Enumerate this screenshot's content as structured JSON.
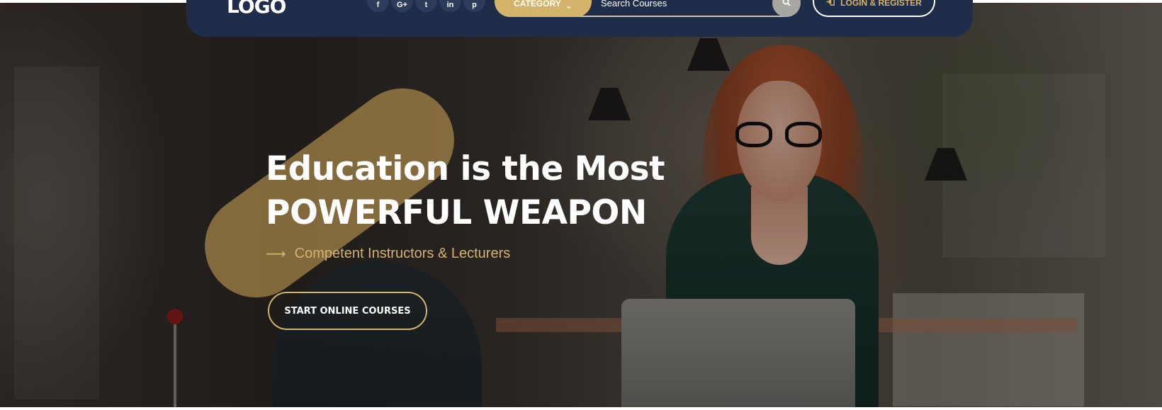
{
  "nav": {
    "logo": "LOGO",
    "socials": [
      {
        "icon": "facebook-icon",
        "glyph": "f"
      },
      {
        "icon": "google-plus-icon",
        "glyph": "G+"
      },
      {
        "icon": "twitter-icon",
        "glyph": "t"
      },
      {
        "icon": "linkedin-icon",
        "glyph": "in"
      },
      {
        "icon": "pinterest-icon",
        "glyph": "p"
      }
    ],
    "category_label": "CATEGORY",
    "category_chevron": "⌄",
    "search_placeholder": "Search Courses",
    "search_icon": "search-icon",
    "login_icon": "sign-in-icon",
    "login_label": "LOGIN & REGISTER"
  },
  "hero": {
    "headline_line1": "Education is the Most",
    "headline_line2": "POWERFUL WEAPON",
    "tagline_arrow": "⟶",
    "tagline": "Competent Instructors & Lecturers",
    "cta_label": "START ONLINE COURSES"
  },
  "colors": {
    "navbar": "#1f2d4a",
    "accent_gold": "#d4b36a",
    "text_white": "#ffffff"
  }
}
